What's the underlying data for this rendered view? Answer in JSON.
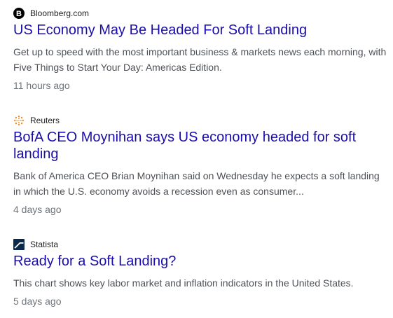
{
  "results": [
    {
      "source": "Bloomberg.com",
      "source_icon": "bloomberg-logo-icon",
      "title": "US Economy May Be Headed For Soft Landing",
      "snippet": "Get up to speed with the most important business & markets news each morning, with Five Things to Start Your Day: Americas Edition.",
      "time": "11 hours ago"
    },
    {
      "source": "Reuters",
      "source_icon": "reuters-logo-icon",
      "title": "BofA CEO Moynihan says US economy headed for soft landing",
      "snippet": "Bank of America CEO Brian Moynihan said on Wednesday he expects a soft landing in which the U.S. economy avoids a recession even as consumer...",
      "time": "4 days ago"
    },
    {
      "source": "Statista",
      "source_icon": "statista-logo-icon",
      "title": "Ready for a Soft Landing?",
      "snippet": "This chart shows key labor market and inflation indicators in the United States.",
      "time": "5 days ago"
    }
  ],
  "colors": {
    "link": "#1a0dab",
    "snippet": "#4d5156",
    "time": "#70757a",
    "reuters_accent": "#f08a24",
    "statista_accent": "#0b2a4a"
  }
}
